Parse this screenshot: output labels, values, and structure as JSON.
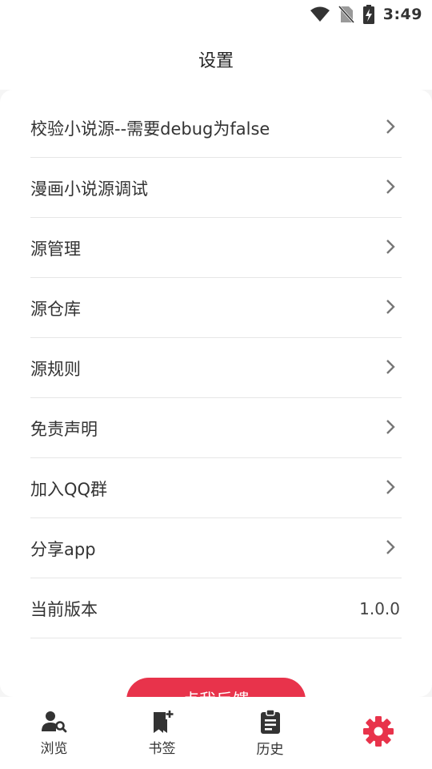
{
  "status_bar": {
    "time": "3:49",
    "icons": [
      "wifi-icon",
      "no-sim-icon",
      "battery-charging-icon"
    ]
  },
  "header": {
    "title": "设置"
  },
  "settings": {
    "items": [
      {
        "label": "校验小说源--需要debug为false",
        "icon": "chevron-right-icon"
      },
      {
        "label": "漫画小说源调试",
        "icon": "chevron-right-icon"
      },
      {
        "label": "源管理",
        "icon": "chevron-right-icon"
      },
      {
        "label": "源仓库",
        "icon": "chevron-right-icon"
      },
      {
        "label": "源规则",
        "icon": "chevron-right-icon"
      },
      {
        "label": "免责声明",
        "icon": "chevron-right-icon"
      },
      {
        "label": "加入QQ群",
        "icon": "chevron-right-icon"
      },
      {
        "label": "分享app",
        "icon": "chevron-right-icon"
      }
    ],
    "version": {
      "label": "当前版本",
      "value": "1.0.0"
    }
  },
  "feedback_button": {
    "label": "点我反馈"
  },
  "bottom_nav": {
    "items": [
      {
        "label": "浏览",
        "icon": "browse-search-icon",
        "active": false
      },
      {
        "label": "书签",
        "icon": "bookmark-add-icon",
        "active": false
      },
      {
        "label": "历史",
        "icon": "clipboard-history-icon",
        "active": false
      },
      {
        "label": "",
        "icon": "gear-icon",
        "active": true
      }
    ]
  },
  "colors": {
    "accent": "#e8334b",
    "text": "#333333",
    "divider": "#e6e6e6",
    "chevron": "#777777"
  }
}
